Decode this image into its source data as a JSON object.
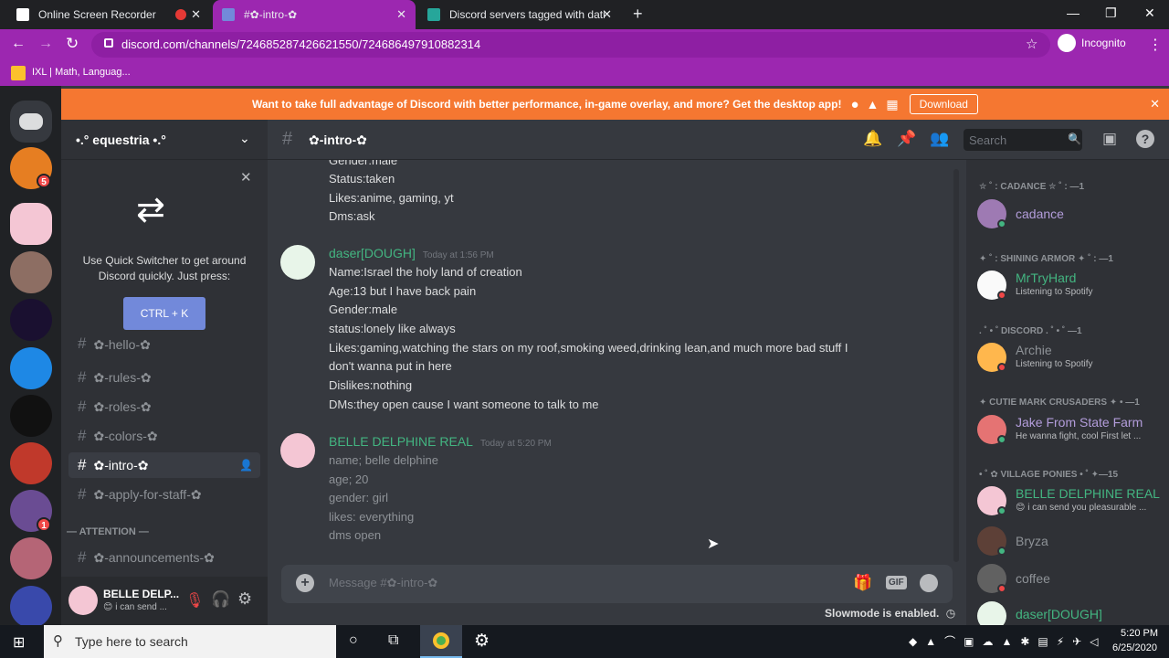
{
  "browser": {
    "tabs": [
      {
        "title": "Online Screen Recorder"
      },
      {
        "title": "#✿-intro-✿"
      },
      {
        "title": "Discord servers tagged with dati"
      }
    ],
    "url": "discord.com/channels/724685287426621550/724686497910882314",
    "profile_label": "Incognito",
    "bookmark": "IXL | Math, Languag..."
  },
  "banner": {
    "text": "Want to take full advantage of Discord with better performance, in-game overlay, and more? Get the desktop app!",
    "download_label": "Download"
  },
  "guilds": {
    "badges": [
      "5",
      "1"
    ]
  },
  "server": {
    "name": "•.° equestria •.°"
  },
  "quickswitcher": {
    "text": "Use Quick Switcher to get around Discord quickly. Just press:",
    "shortcut": "CTRL + K"
  },
  "channels": {
    "items": [
      {
        "name": "✿-hello-✿"
      },
      {
        "name": "✿-rules-✿"
      },
      {
        "name": "✿-roles-✿"
      },
      {
        "name": "✿-colors-✿"
      },
      {
        "name": "✿-intro-✿"
      },
      {
        "name": "✿-apply-for-staff-✿"
      }
    ],
    "category": "— ATTENTION —",
    "announcements": "✿-announcements-✿"
  },
  "user_panel": {
    "name": "BELLE DELP...",
    "status": "😊 i can send ..."
  },
  "header": {
    "channel": "✿-intro-✿",
    "search_placeholder": "Search"
  },
  "messages": {
    "first_lines": [
      "Gender:male",
      "Status:taken",
      "Likes:anime, gaming, yt",
      "Dms:ask"
    ],
    "msg1": {
      "author": "daser[DOUGH]",
      "timestamp": "Today at 1:56 PM",
      "lines": [
        "Name:Israel the holy land of creation",
        "Age:13 but I have back pain",
        "Gender:male",
        "status:lonely like always",
        "Likes:gaming,watching the stars on my roof,smoking weed,drinking lean,and much more bad stuff I",
        "don't wanna put in here",
        "Dislikes:nothing",
        "DMs:they open cause I want someone to talk to me"
      ]
    },
    "msg2": {
      "author": "BELLE DELPHINE REAL",
      "timestamp": "Today at 5:20 PM",
      "lines": [
        "name; belle delphine",
        "age; 20",
        "gender: girl",
        "likes: everything",
        "dms open"
      ]
    }
  },
  "composer": {
    "placeholder": "Message #✿-intro-✿",
    "gif_label": "GIF",
    "slowmode": "Slowmode is enabled."
  },
  "members": {
    "categories": [
      "✮ ˚ : CADANCE ✮ ˚ : —1",
      "✦ ˚ : SHINING ARMOR ✦ ˚ : —1",
      ". ˚ • ˚ DISCORD . ˚ • ˚ —1",
      "✦ CUTIE MARK CRUSADERS ✦ • —1",
      "• ˚ ✿ VILLAGE PONIES • ˚ ✦—15"
    ],
    "list": [
      {
        "name": "cadance",
        "status": ""
      },
      {
        "name": "MrTryHard",
        "status": "Listening to Spotify"
      },
      {
        "name": "Archie",
        "status": "Listening to Spotify"
      },
      {
        "name": "Jake From State Farm",
        "status": "He wanna fight, cool First let ..."
      },
      {
        "name": "BELLE DELPHINE REAL",
        "status": "😊 i can send you pleasurable ..."
      },
      {
        "name": "Bryza",
        "status": ""
      },
      {
        "name": "coffee",
        "status": ""
      },
      {
        "name": "daser[DOUGH]",
        "status": ""
      }
    ]
  },
  "taskbar": {
    "search_placeholder": "Type here to search",
    "time": "5:20 PM",
    "date": "6/25/2020"
  },
  "colors": {
    "accent": "#9c27b0",
    "blurple": "#7289da",
    "banner": "#f57731",
    "green_name": "#43b581"
  }
}
